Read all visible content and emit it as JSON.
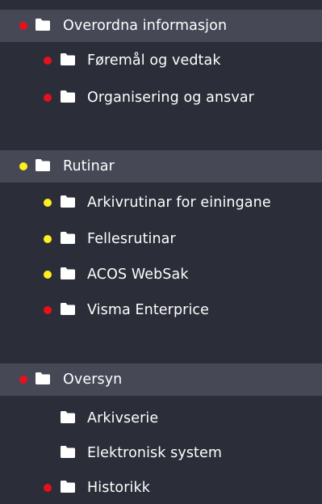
{
  "colors": {
    "background": "#2b2d38",
    "header_background": "#464856",
    "text": "#ffffff",
    "status_red": "#e8101b",
    "status_yellow": "#ffee20"
  },
  "sections": [
    {
      "label": "Overordna informasjon",
      "status": "red",
      "items": [
        {
          "label": "Føremål og vedtak",
          "status": "red"
        },
        {
          "label": "Organisering og ansvar",
          "status": "red"
        }
      ]
    },
    {
      "label": "Rutinar",
      "status": "yellow",
      "items": [
        {
          "label": "Arkivrutinar for einingane",
          "status": "yellow"
        },
        {
          "label": "Fellesrutinar",
          "status": "yellow"
        },
        {
          "label": "ACOS WebSak",
          "status": "yellow"
        },
        {
          "label": "Visma Enterprice",
          "status": "red"
        }
      ]
    },
    {
      "label": "Oversyn",
      "status": "red",
      "items": [
        {
          "label": "Arkivserie",
          "status": "none"
        },
        {
          "label": "Elektronisk system",
          "status": "none"
        },
        {
          "label": "Historikk",
          "status": "red"
        }
      ]
    }
  ]
}
